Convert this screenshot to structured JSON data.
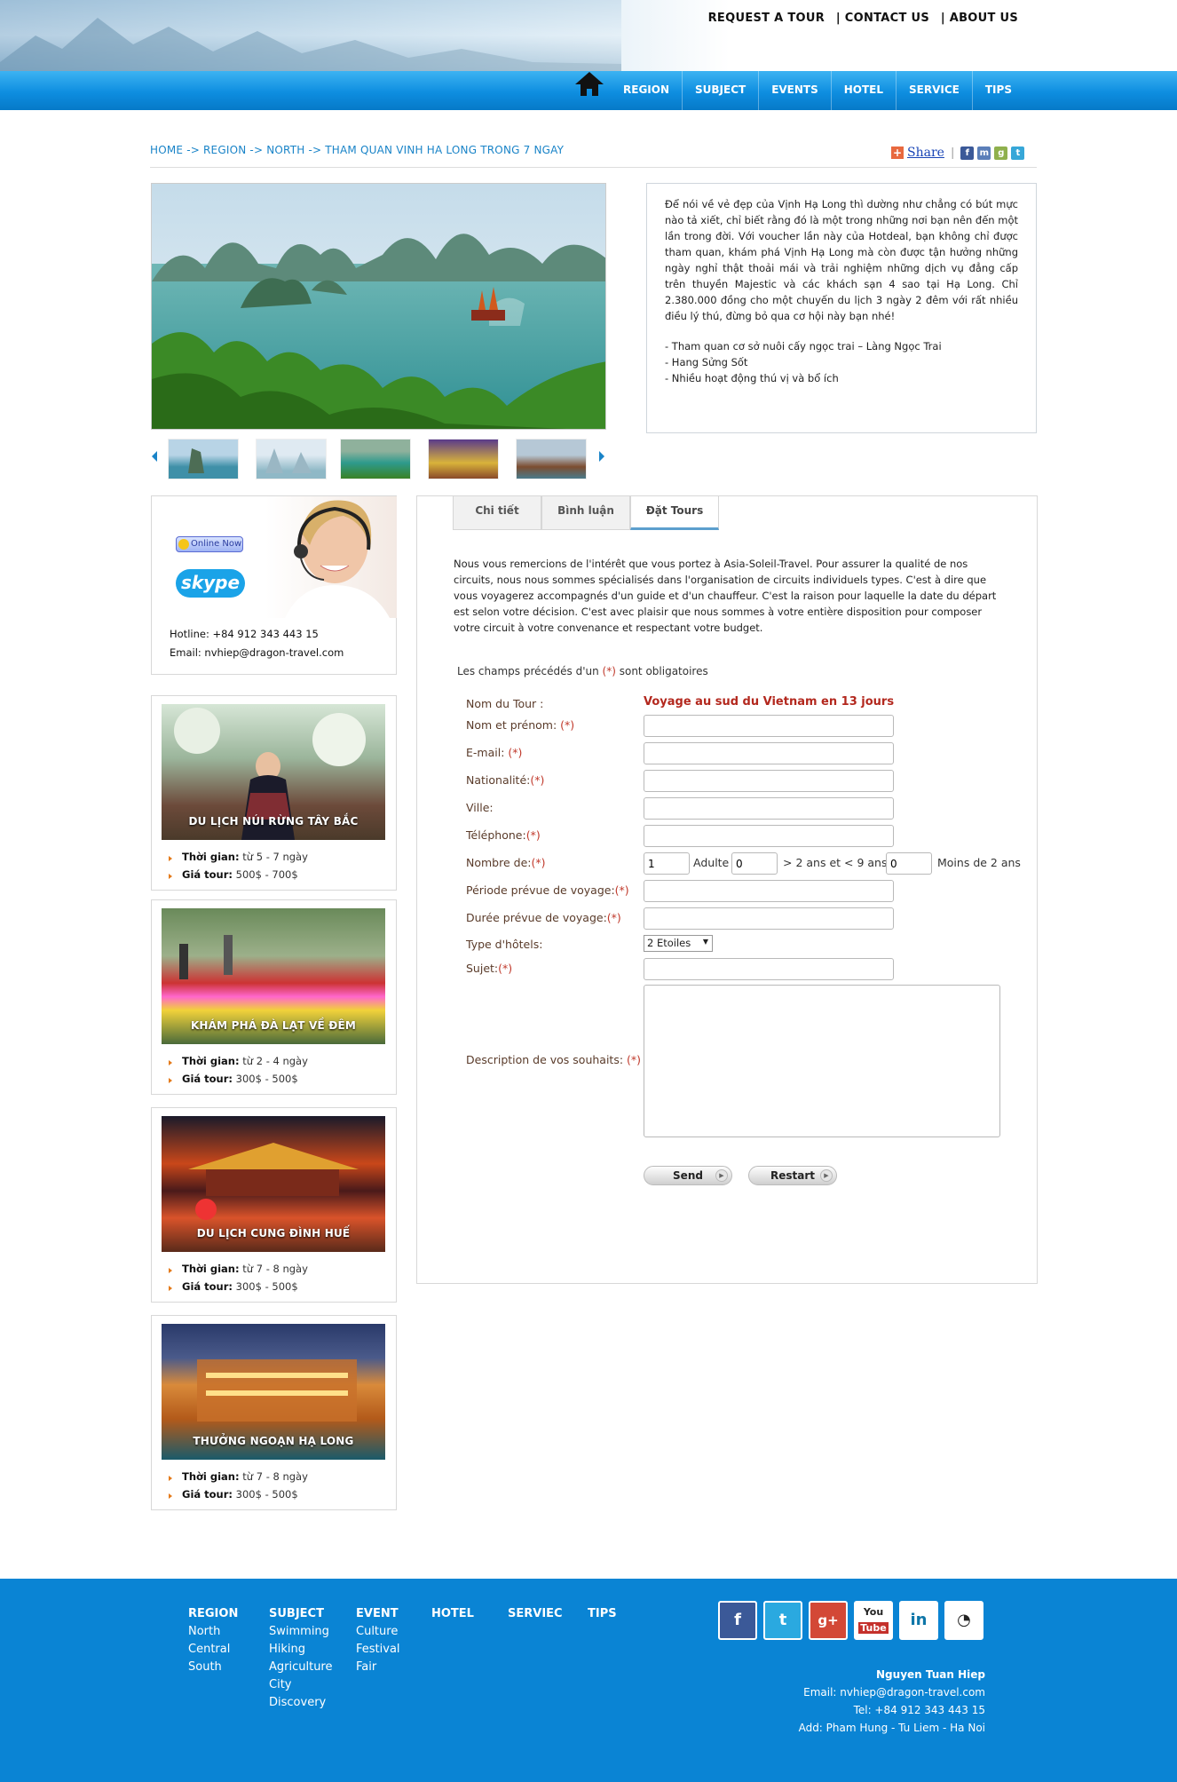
{
  "header": {
    "toplinks": [
      "REQUEST A TOUR",
      "| CONTACT US",
      "| ABOUT US"
    ],
    "nav": [
      "REGION",
      "SUBJECT",
      "EVENTS",
      "HOTEL",
      "SERVICE",
      "TIPS"
    ]
  },
  "breadcrumb": "HOME -> REGION -> NORTH -> THAM QUAN VINH HA LONG TRONG 7 NGAY",
  "share": {
    "label": "Share",
    "separator": "|"
  },
  "description": {
    "text": "Để nói về vẻ đẹp của Vịnh Hạ Long thì dường như chẳng có bút mực nào tả xiết, chỉ biết rằng đó là một trong những nơi bạn nên đến một lần trong đời. Với voucher lần này của Hotdeal, bạn không chỉ được tham quan, khám phá Vịnh Hạ Long mà còn được tận hưởng những ngày nghỉ thật thoải mái và trải nghiệm những dịch vụ đẳng cấp trên thuyền Majestic và các khách sạn 4 sao tại Hạ Long. Chỉ 2.380.000 đồng cho một chuyến du lịch 3 ngày 2 đêm với rất nhiều điều lý thú, đừng bỏ qua cơ hội này bạn nhé!",
    "bullets": [
      "- Tham quan cơ sở nuôi cấy ngọc trai – Làng Ngọc Trai",
      "- Hang Sửng Sốt",
      "- Nhiều hoạt động thú vị và bổ ích"
    ]
  },
  "support": {
    "online": "Online Now",
    "skype": "skype",
    "hotline": "Hotline: +84 912 343 443 15",
    "email": "Email: nvhiep@dragon-travel.com"
  },
  "tours": [
    {
      "caption": "DU LỊCH NÚI RỪNG TÂY BẮC",
      "time_label": "Thời gian:",
      "time": "từ 5 - 7 ngày",
      "price_label": "Giá tour:",
      "price": "500$ - 700$"
    },
    {
      "caption": "KHÁM PHÁ ĐÀ LẠT VỀ ĐÊM",
      "time_label": "Thời gian:",
      "time": "từ 2 - 4 ngày",
      "price_label": "Giá tour:",
      "price": "300$ - 500$"
    },
    {
      "caption": "DU LỊCH CUNG ĐÌNH HUẾ",
      "time_label": "Thời gian:",
      "time": "từ 7 - 8 ngày",
      "price_label": "Giá tour:",
      "price": "300$ - 500$"
    },
    {
      "caption": "THƯỞNG NGOẠN HẠ LONG",
      "time_label": "Thời gian:",
      "time": "từ 7 - 8 ngày",
      "price_label": "Giá tour:",
      "price": "300$ - 500$"
    }
  ],
  "tabs": [
    "Chi tiết",
    "Bình luận",
    "Đặt Tours"
  ],
  "intro": "Nous vous remercions de l'intérêt que vous portez à Asia-Soleil-Travel. Pour assurer la qualité de nos circuits, nous nous sommes spécialisés dans l'organisation de circuits individuels types. C'est à dire que vous voyagerez accompagnés d'un guide et d'un chauffeur. C'est la raison pour laquelle la date du départ est selon votre décision. C'est avec plaisir que nous sommes à votre entière disposition pour composer votre circuit à votre convenance et respectant votre budget.",
  "form": {
    "required_note": "Les champs précédés d'un",
    "required_mark": "(*)",
    "required_tail": "sont obligatoires",
    "tour_label": "Nom du Tour :",
    "tour_name": "Voyage au sud du Vietnam en 13 jours",
    "labels": {
      "name": "Nom et prénom:",
      "email": "E-mail:",
      "nationality": "Nationalité:",
      "city": "Ville:",
      "phone": "Téléphone:",
      "count": "Nombre de:",
      "period": "Période prévue de voyage:",
      "duration": "Durée prévue de voyage:",
      "hotel": "Type d'hôtels:",
      "subject": "Sujet:",
      "wishes": "Description de vos souhaits:"
    },
    "adult_value": "1",
    "adult_label": "Adulte",
    "child_value": "0",
    "child_label": "> 2 ans et < 9 ans",
    "baby_value": "0",
    "baby_label": "Moins de 2 ans",
    "hotel_value": "2 Etoiles",
    "send": "Send",
    "reset": "Restart"
  },
  "footer": {
    "region": {
      "title": "REGION",
      "items": [
        "North",
        "Central",
        "South"
      ]
    },
    "subject": {
      "title": "SUBJECT",
      "items": [
        "Swimming",
        "Hiking",
        "Agriculture",
        "City",
        "Discovery"
      ]
    },
    "event": {
      "title": "EVENT",
      "items": [
        "Culture",
        "Festival",
        "Fair"
      ]
    },
    "hotel": {
      "title": "HOTEL"
    },
    "service": {
      "title": "SERVIEC"
    },
    "tips": {
      "title": "TIPS"
    },
    "contact": {
      "name": "Nguyen Tuan Hiep",
      "email": "Email: nvhiep@dragon-travel.com",
      "tel": "Tel: +84 912 343 443 15",
      "add": "Add: Pham Hung - Tu Liem - Ha Noi"
    },
    "social_icons": [
      "facebook-icon",
      "twitter-icon",
      "google-plus-icon",
      "youtube-icon",
      "linkedin-icon",
      "rss-icon"
    ]
  },
  "colors": {
    "nav_blue": "#0e8ee0",
    "link_blue": "#1a84c8",
    "footer_blue": "#0a84d4",
    "tour_red": "#b3281e"
  }
}
